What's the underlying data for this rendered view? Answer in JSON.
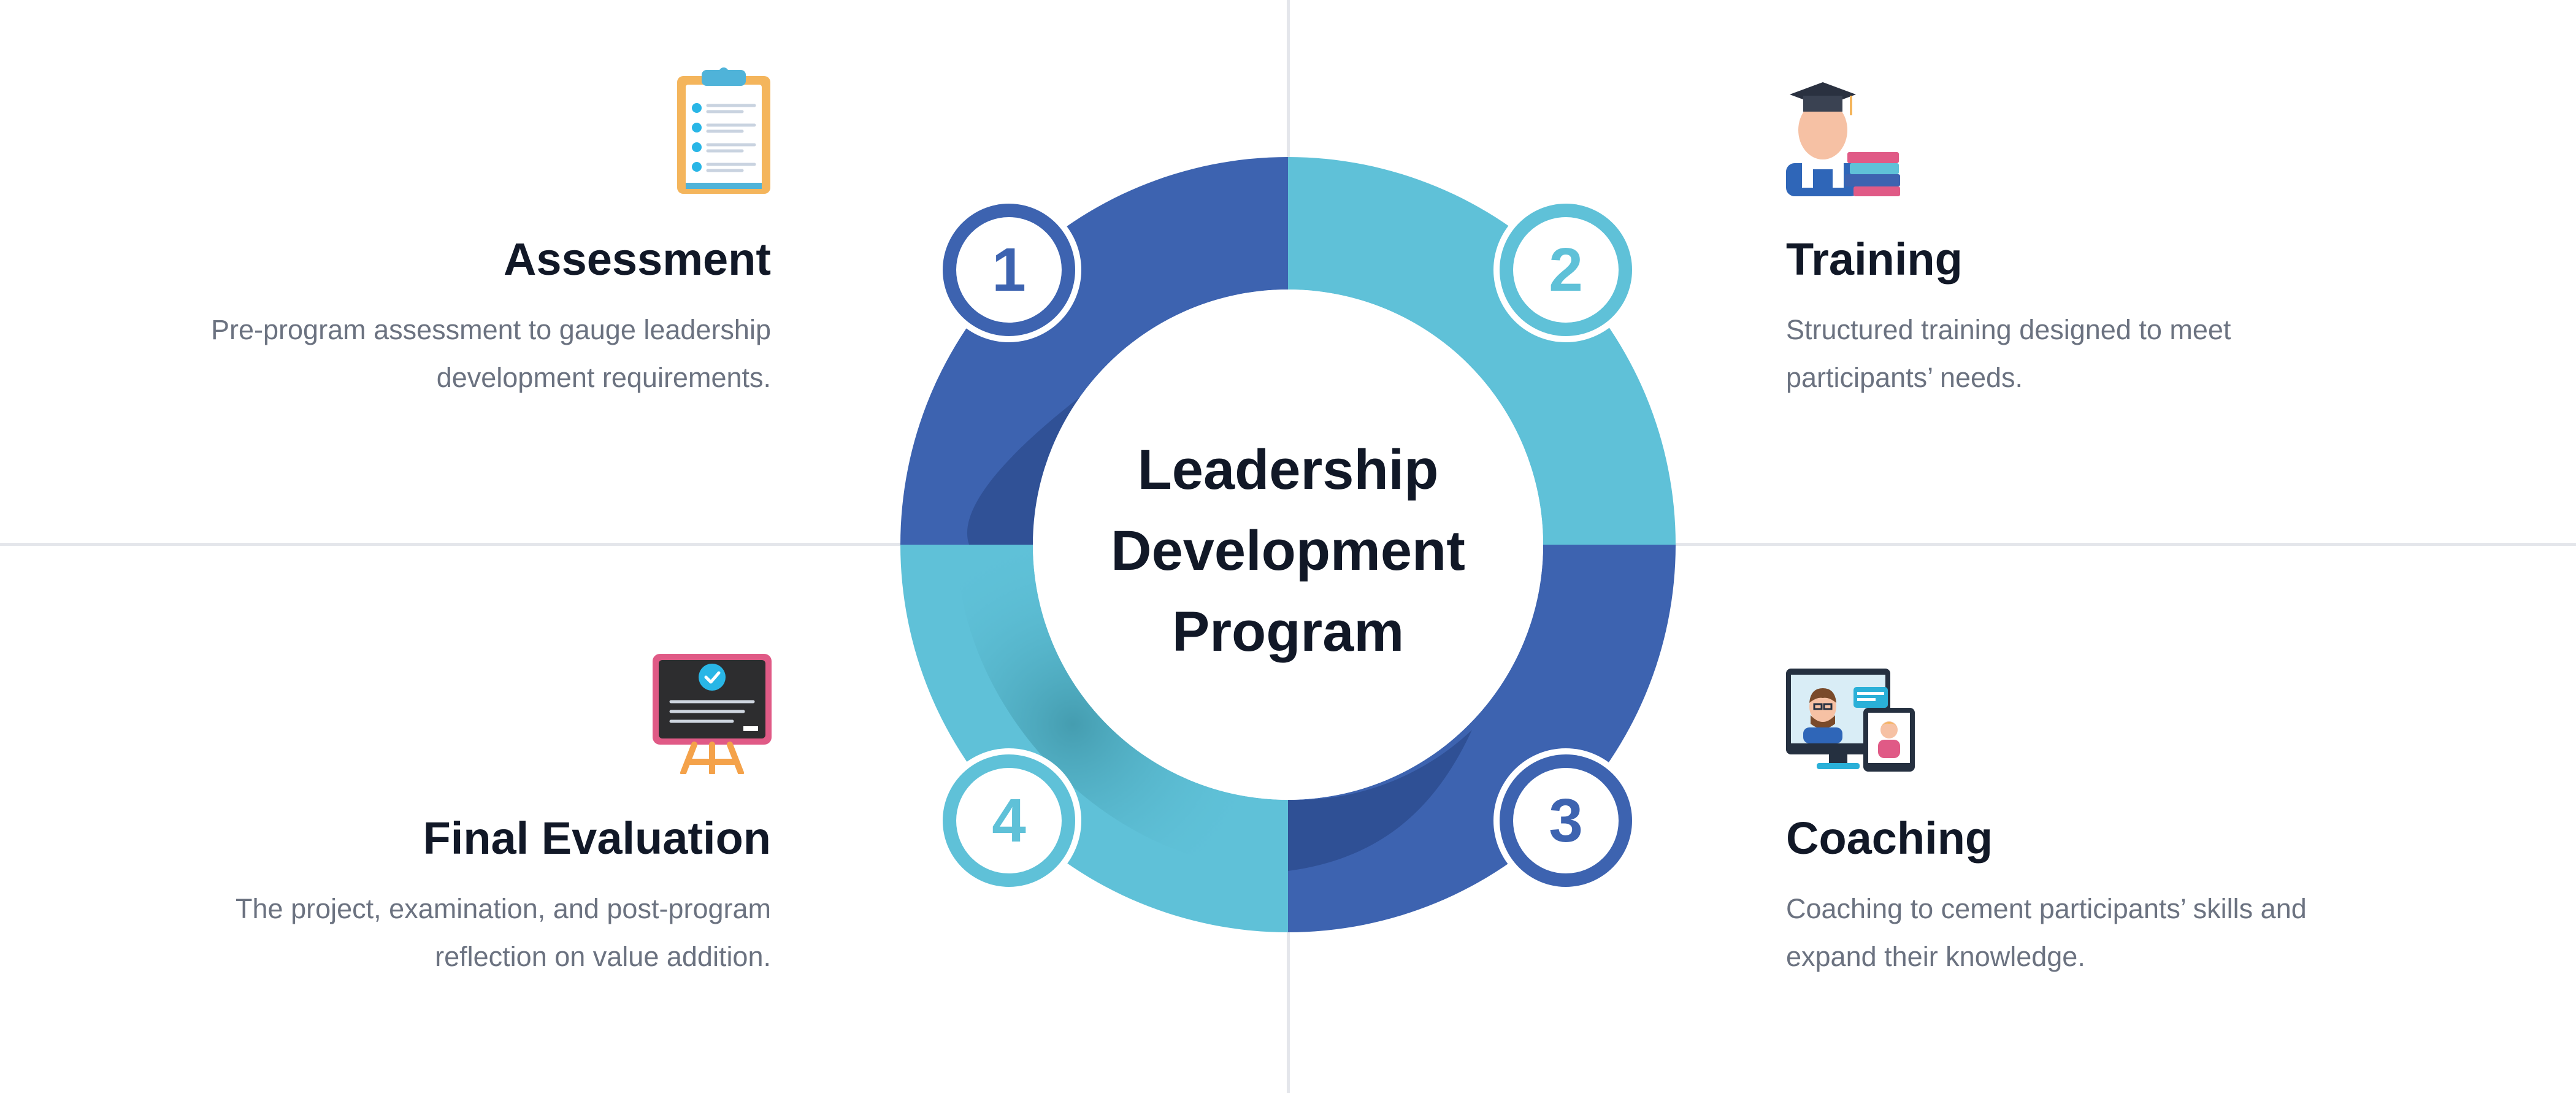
{
  "center": {
    "line1": "Leadership",
    "line2": "Development",
    "line3": "Program"
  },
  "steps": [
    {
      "number": "1",
      "title": "Assessment",
      "desc_line1": "Pre-program assessment to gauge leadership",
      "desc_line2": "development requirements.",
      "icon": "clipboard-checklist-icon"
    },
    {
      "number": "2",
      "title": "Training",
      "desc_line1": "Structured training designed to meet",
      "desc_line2": "participants’ needs.",
      "icon": "graduate-books-icon"
    },
    {
      "number": "3",
      "title": "Coaching",
      "desc_line1": "Coaching to cement participants’ skills and",
      "desc_line2": "expand their knowledge.",
      "icon": "video-coaching-icon"
    },
    {
      "number": "4",
      "title": "Final Evaluation",
      "desc_line1": "The project, examination, and post-program",
      "desc_line2": "reflection on value addition.",
      "icon": "presentation-board-icon"
    }
  ],
  "colors": {
    "dark_blue": "#3d63b0",
    "light_blue": "#5fc1d8",
    "text_dark": "#111827",
    "text_gray": "#6b7280",
    "divider": "#e4e6eb"
  }
}
